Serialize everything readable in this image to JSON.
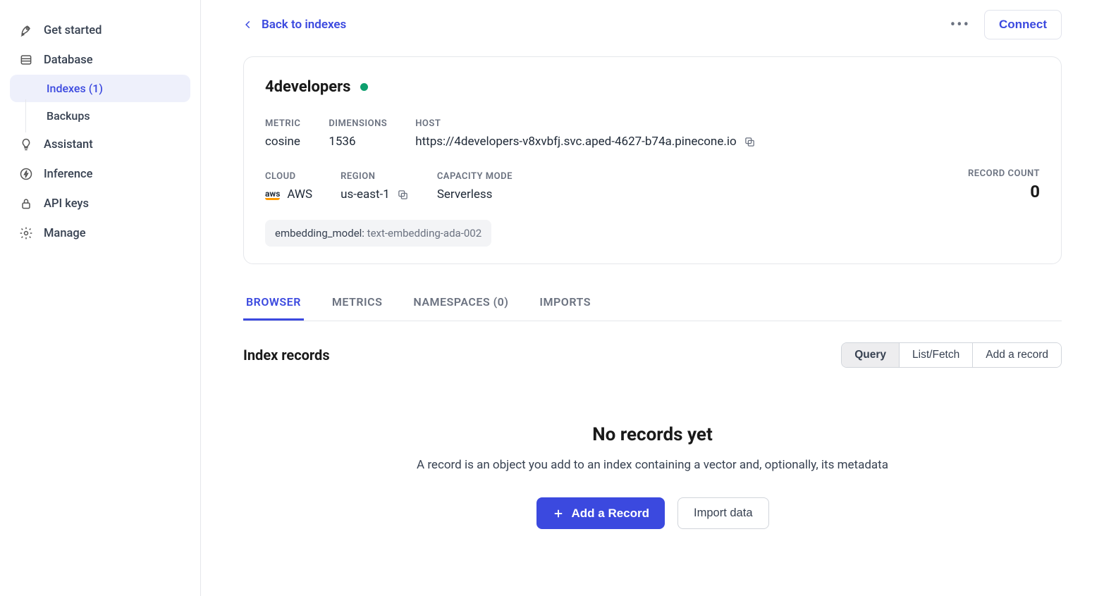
{
  "sidebar": {
    "items": [
      {
        "label": "Get started"
      },
      {
        "label": "Database"
      },
      {
        "label": "Assistant"
      },
      {
        "label": "Inference"
      },
      {
        "label": "API keys"
      },
      {
        "label": "Manage"
      }
    ],
    "database_children": [
      {
        "label": "Indexes (1)",
        "active": true
      },
      {
        "label": "Backups",
        "active": false
      }
    ]
  },
  "topbar": {
    "back_label": "Back to indexes",
    "connect_label": "Connect"
  },
  "index": {
    "name": "4developers",
    "metric_label": "METRIC",
    "metric_value": "cosine",
    "dimensions_label": "DIMENSIONS",
    "dimensions_value": "1536",
    "host_label": "HOST",
    "host_value": "https://4developers-v8xvbfj.svc.aped-4627-b74a.pinecone.io",
    "cloud_label": "CLOUD",
    "cloud_value": "AWS",
    "region_label": "REGION",
    "region_value": "us-east-1",
    "capacity_label": "CAPACITY MODE",
    "capacity_value": "Serverless",
    "record_count_label": "RECORD COUNT",
    "record_count_value": "0",
    "tag_key": "embedding_model:",
    "tag_value": "text-embedding-ada-002"
  },
  "tabs": [
    {
      "label": "BROWSER",
      "active": true
    },
    {
      "label": "METRICS",
      "active": false
    },
    {
      "label": "NAMESPACES (0)",
      "active": false
    },
    {
      "label": "IMPORTS",
      "active": false
    }
  ],
  "records": {
    "title": "Index records",
    "segmented": [
      {
        "label": "Query",
        "active": true
      },
      {
        "label": "List/Fetch",
        "active": false
      },
      {
        "label": "Add a record",
        "active": false
      }
    ],
    "empty_title": "No records yet",
    "empty_sub": "A record is an object you add to an index containing a vector and, optionally, its metadata",
    "add_button": "Add a Record",
    "import_button": "Import data"
  }
}
